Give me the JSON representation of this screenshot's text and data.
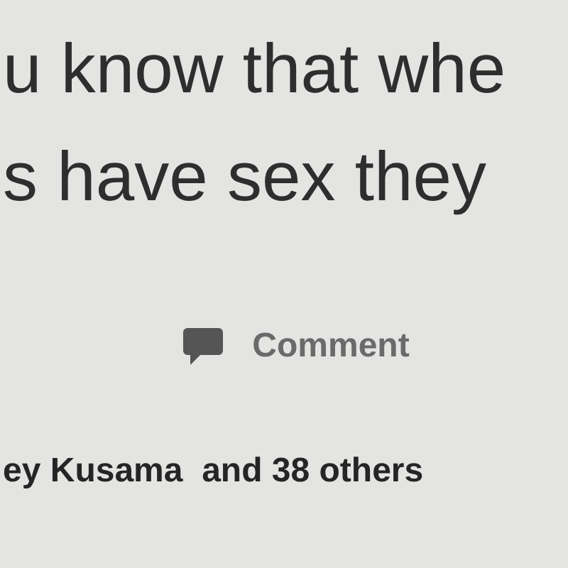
{
  "post": {
    "text_lines": [
      "u know that whe",
      "s have sex they"
    ]
  },
  "actions": [
    {
      "kind": "comment",
      "label": "Comment"
    }
  ],
  "reactions": {
    "text": "ey Kusama  and 38 others"
  }
}
